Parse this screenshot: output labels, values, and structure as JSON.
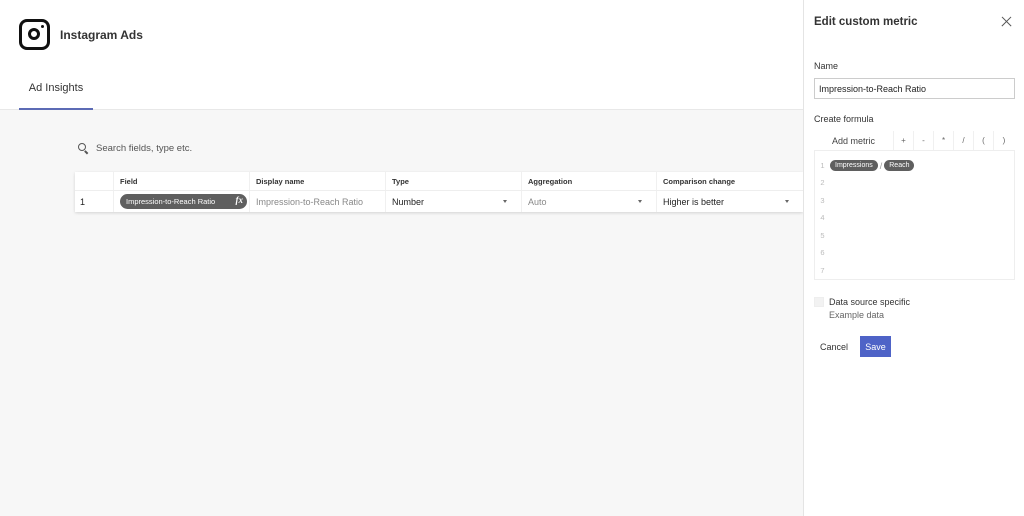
{
  "app": {
    "title": "Instagram Ads",
    "logo_icon": "instagram-icon"
  },
  "tabs": [
    {
      "label": "Ad Insights",
      "active": true
    }
  ],
  "search": {
    "placeholder": "Search fields, type etc.",
    "value": ""
  },
  "table": {
    "columns": [
      "",
      "Field",
      "Display name",
      "Type",
      "Aggregation",
      "Comparison change"
    ],
    "rows": [
      {
        "index": "1",
        "field": "Impression-to-Reach Ratio",
        "field_icon": "fx",
        "display_name": "Impression-to-Reach Ratio",
        "type": "Number",
        "aggregation": "Auto",
        "comparison": "Higher is better"
      }
    ]
  },
  "panel": {
    "title": "Edit custom metric",
    "name_label": "Name",
    "name_value": "Impression-to-Reach Ratio",
    "formula_label": "Create formula",
    "add_metric": "Add metric",
    "operators": [
      "+",
      "-",
      "*",
      "/",
      "(",
      ")"
    ],
    "line_numbers": [
      "1",
      "2",
      "3",
      "4",
      "5",
      "6",
      "7"
    ],
    "formula": {
      "left": "Impressions",
      "operator": "/",
      "right": "Reach"
    },
    "checkbox_label": "Data source specific",
    "checkbox_sub": "Example data",
    "checkbox_checked": false,
    "cancel": "Cancel",
    "save": "Save"
  },
  "colors": {
    "accent": "#4e63c7",
    "tab_underline": "#5c6bb5",
    "pill": "#5f5f5f"
  }
}
